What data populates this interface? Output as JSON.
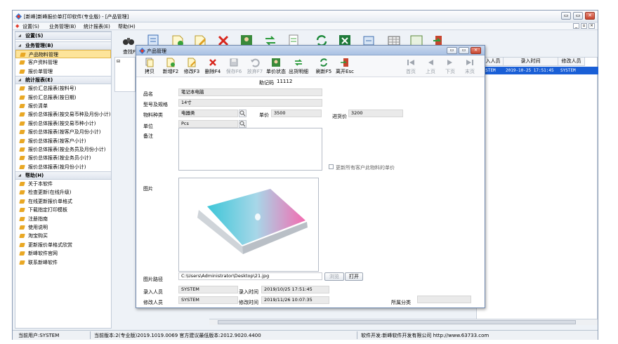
{
  "app": {
    "title": "[新峰]新峰报价单打印软件(专业版) - [产品管理]",
    "window_buttons": {
      "minimize": "▭",
      "maximize": "▭",
      "close": "✕"
    }
  },
  "menu": {
    "items": [
      "设置(S)",
      "业务管理(B)",
      "统计报表(E)",
      "帮助(H)"
    ],
    "mdi_buttons": [
      "_",
      "▫",
      "×"
    ]
  },
  "nav": {
    "groups": [
      {
        "header": "设置(S)",
        "items": []
      },
      {
        "header": "业务管理(B)",
        "items": [
          "产品物料管理",
          "客户资料管理",
          "报价单管理"
        ]
      },
      {
        "header": "统计报表(E)",
        "items": [
          "报价汇总报表(按料号)",
          "报价汇总报表(按日期)",
          "报价清单",
          "报价总体报表(按交易币种及月份小计)",
          "报价总体报表(按交易币种小计)",
          "报价总体报表(按客户及月份小计)",
          "报价总体报表(按客户小计)",
          "报价总体报表(按业务员及月份小计)",
          "报价总体报表(按业务员小计)",
          "报价总体报表(按月份小计)"
        ]
      },
      {
        "header": "帮助(H)",
        "items": [
          "关于本软件",
          "检查更新(在线升级)",
          "在线更新报价单格式",
          "下载指定打印模板",
          "注册指南",
          "使用说明",
          "淘宝购买",
          "更新报价单格式欣赏",
          "新峰软件官网",
          "联系新峰软件"
        ]
      }
    ],
    "selected": "产品物料管理"
  },
  "main_toolbar": {
    "first_label": "查找F"
  },
  "grid": {
    "headers": [
      "录入人员",
      "录入时间",
      "修改人员"
    ],
    "row": {
      "creator": "SYSTEM",
      "created": "2019-10-25 17:51:45",
      "modifier": "SYSTEM"
    }
  },
  "status": {
    "user": "当前用户:SYSTEM",
    "version": "当前版本:2(专业版)2019.1019.0069 官方建议最低版本:2012.9020.4400",
    "developer": "软件开发:新峰软件开发有限公司 http://www.63733.com"
  },
  "dialog": {
    "title": "产品管理",
    "toolbar": [
      {
        "label": "拷贝",
        "icon": "copy-icon",
        "enabled": true
      },
      {
        "label": "新增F2",
        "icon": "add-icon",
        "enabled": true
      },
      {
        "label": "修改F3",
        "icon": "edit-icon",
        "enabled": true
      },
      {
        "label": "删除F4",
        "icon": "delete-icon",
        "enabled": true
      },
      {
        "label": "保存F6",
        "icon": "save-icon",
        "enabled": false
      },
      {
        "label": "放弃F7",
        "icon": "undo-icon",
        "enabled": false
      },
      {
        "label": "单价状态",
        "icon": "price-status-icon",
        "enabled": true
      },
      {
        "label": "出货明细",
        "icon": "shipment-icon",
        "enabled": true
      },
      {
        "label": "刷新F5",
        "icon": "refresh-icon",
        "enabled": true
      },
      {
        "label": "离开Esc",
        "icon": "exit-icon",
        "enabled": true
      }
    ],
    "nav_buttons": [
      "首页",
      "上页",
      "下页",
      "末页"
    ],
    "fields": {
      "memo_code_label": "助记码",
      "memo_code": "11112",
      "name_label": "品名",
      "name": "笔记本电脑",
      "model_label": "型号及规格",
      "model": "14寸",
      "category_label": "物料种类",
      "category": "电器类",
      "unit_price_label": "单价",
      "unit_price": "3500",
      "purchase_price_label": "进货价",
      "purchase_price": "3200",
      "unit_label": "单位",
      "unit": "Pcs",
      "remark_label": "备注",
      "remark": "",
      "update_all_label": "更新所有客户此物料的单价",
      "image_label": "图片",
      "image_path_label": "图片路径",
      "image_path": "C:\\Users\\Administrator\\Desktop\\21.jpg",
      "browse_label": "浏览",
      "open_label": "打开",
      "creator_label": "录入人员",
      "creator": "SYSTEM",
      "created_label": "录入时间",
      "created": "2019/10/25 17:51:45",
      "modifier_label": "修改人员",
      "modifier": "SYSTEM",
      "modified_label": "修改时间",
      "modified": "2019/11/26 10:07:35",
      "class_label": "所属分类",
      "class": ""
    }
  },
  "colors": {
    "selection": "#1a5fd6",
    "nav_selected": "#fde49a",
    "title_gradient_top": "#c9d8ee"
  }
}
